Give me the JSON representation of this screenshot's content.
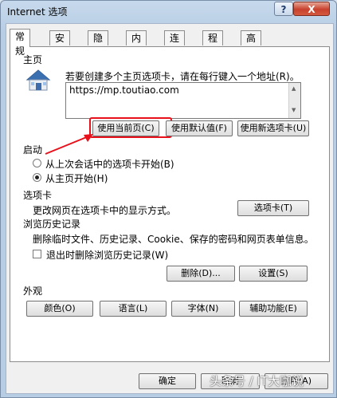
{
  "window": {
    "title": "Internet 选项",
    "help_label": "?",
    "close_label": "X"
  },
  "tabs": [
    {
      "label": "常规",
      "active": true
    },
    {
      "label": "安全"
    },
    {
      "label": "隐私"
    },
    {
      "label": "内容"
    },
    {
      "label": "连接"
    },
    {
      "label": "程序"
    },
    {
      "label": "高级"
    }
  ],
  "home": {
    "section_title": "主页",
    "instruction": "若要创建多个主页选项卡，请在每行键入一个地址(R)。",
    "url": "https://mp.toutiao.com",
    "use_current_label": "使用当前页(C)",
    "use_default_label": "使用默认值(F)",
    "use_new_tab_label": "使用新选项卡(U)"
  },
  "startup": {
    "section_title": "启动",
    "option_last_session": "从上次会话中的选项卡开始(B)",
    "option_home": "从主页开始(H)",
    "selected": "home"
  },
  "tabs_section": {
    "section_title": "选项卡",
    "description": "更改网页在选项卡中的显示方式。",
    "button_label": "选项卡(T)"
  },
  "history": {
    "section_title": "浏览历史记录",
    "description": "删除临时文件、历史记录、Cookie、保存的密码和网页表单信息。",
    "delete_on_exit_label": "退出时删除浏览历史记录(W)",
    "delete_label": "删除(D)...",
    "settings_label": "设置(S)"
  },
  "appearance": {
    "section_title": "外观",
    "colors_label": "颜色(O)",
    "languages_label": "语言(L)",
    "fonts_label": "字体(N)",
    "accessibility_label": "辅助功能(E)"
  },
  "footer": {
    "ok_label": "确定",
    "cancel_label": "取消",
    "apply_label": "应用(A)"
  },
  "watermark": "头条号 / IT大咖说",
  "colors": {
    "highlight": "#e8101a",
    "annotation_arrow": "#e8101a"
  }
}
